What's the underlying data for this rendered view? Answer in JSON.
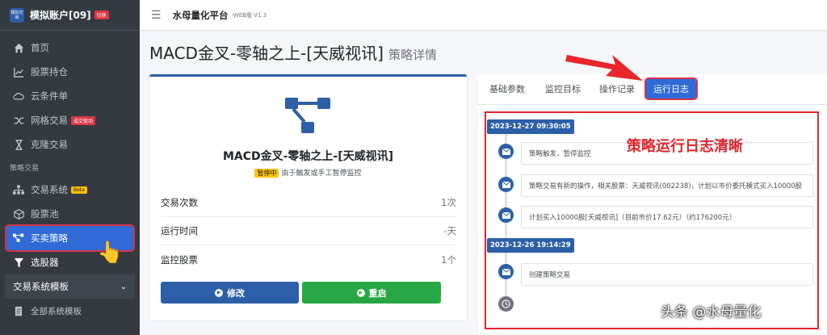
{
  "brand": {
    "logo_text": "模拟交易",
    "title": "模拟账户[09]",
    "badge": "切换"
  },
  "sidebar": {
    "items": [
      {
        "label": "首页",
        "icon": "home-icon"
      },
      {
        "label": "股票持仓",
        "icon": "chart-line-icon"
      },
      {
        "label": "云条件单",
        "icon": "cloud-icon"
      },
      {
        "label": "网格交易",
        "icon": "shuffle-icon",
        "tag": "成交驱动"
      },
      {
        "label": "克隆交易",
        "icon": "hourglass-icon"
      }
    ],
    "section_header": "策略交易",
    "strategy_items": [
      {
        "label": "交易系统",
        "icon": "sitemap-icon",
        "tag": "Beta"
      },
      {
        "label": "股票池",
        "icon": "cube-icon"
      },
      {
        "label": "买卖策略",
        "icon": "strategy-icon"
      },
      {
        "label": "选股器",
        "icon": "filter-icon"
      }
    ],
    "template_menu": "交易系统模板",
    "template_sub": "全部系统模板"
  },
  "topbar": {
    "title": "水母量化平台",
    "version": "-WEB版 V1.3"
  },
  "page": {
    "title": "MACD金叉-零轴之上-[天威视讯]",
    "subtitle": "策略详情"
  },
  "strategy": {
    "name": "MACD金叉-零轴之上-[天威视讯]",
    "status_badge": "暂停中",
    "status_text": "由于触发或手工暂停监控",
    "stats": [
      {
        "label": "交易次数",
        "value": "1次"
      },
      {
        "label": "运行时间",
        "value": "-天"
      },
      {
        "label": "监控股票",
        "value": "1个"
      }
    ],
    "buttons": {
      "edit": "修改",
      "restart": "重启"
    }
  },
  "tabs": [
    "基础参数",
    "监控目标",
    "操作记录",
    "运行日志"
  ],
  "log": {
    "groups": [
      {
        "date": "2023-12-27 09:30:05",
        "entries": [
          "策略触发，暂停监控",
          "策略交易有新的操作，相关股票：天威视讯(002238)，计划以市价委托模式买入10000股",
          "计划买入10000股[天威视讯]（目前市价17.62元）（约176200元）"
        ]
      },
      {
        "date": "2023-12-26 19:14:29",
        "entries": [
          "创建策略交易"
        ]
      }
    ]
  },
  "annotation": {
    "callout": "策略运行日志清晰",
    "watermark": "头条 @水母量化"
  },
  "colors": {
    "primary": "#2c5fa8",
    "success": "#28a745",
    "warning": "#ffc107",
    "highlight": "#e0252c",
    "sidebar": "#343a40"
  }
}
